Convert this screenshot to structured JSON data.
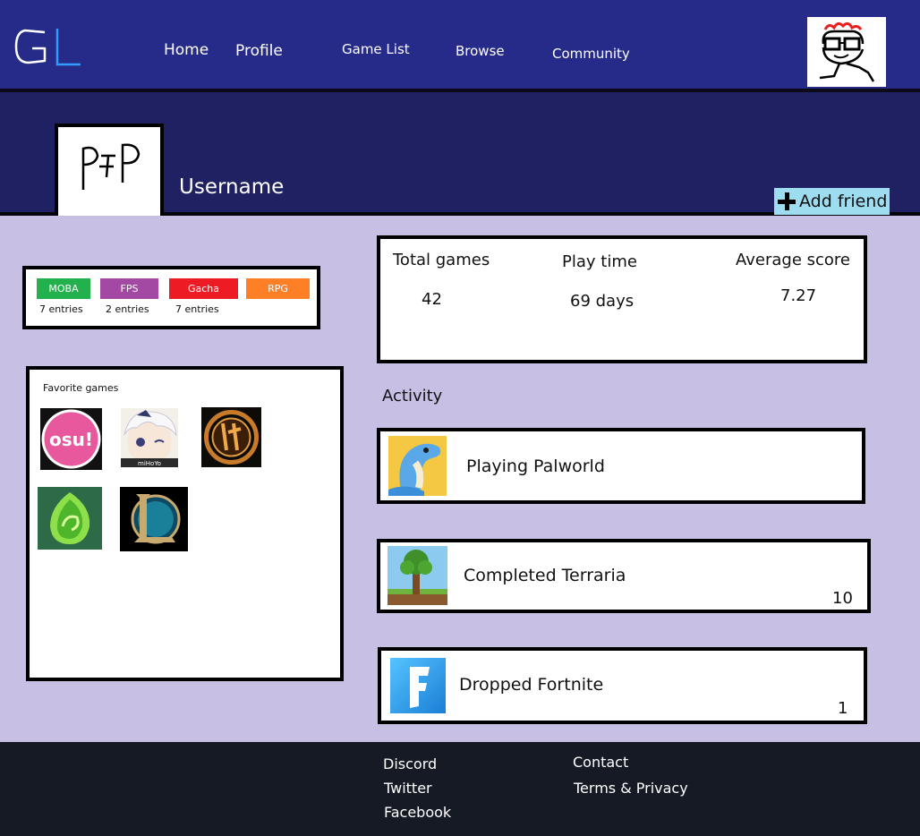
{
  "header": {
    "logo_text": "GL",
    "nav": {
      "home": "Home",
      "profile": "Profile",
      "game_list": "Game List",
      "browse": "Browse",
      "community": "Community"
    }
  },
  "profile": {
    "pfp_placeholder": "PFP",
    "username": "Username",
    "add_friend": "Add friend"
  },
  "tags": [
    {
      "label": "MOBA",
      "count": "7 entries",
      "color": "#22b14c"
    },
    {
      "label": "FPS",
      "count": "2 entries",
      "color": "#a349a4"
    },
    {
      "label": "Gacha",
      "count": "7 entries",
      "color": "#ed1c24"
    },
    {
      "label": "RPG",
      "count": "",
      "color": "#ff7f27"
    }
  ],
  "favorites": {
    "title": "Favorite games",
    "games": [
      {
        "icon": "osu-icon",
        "text": "osu!"
      },
      {
        "icon": "genshin-paimon-icon",
        "text": "miHoYo"
      },
      {
        "icon": "star-wars-old-republic-icon"
      },
      {
        "icon": "green-dragon-egg-icon"
      },
      {
        "icon": "league-of-legends-icon"
      }
    ]
  },
  "stats": {
    "total_games_label": "Total games",
    "total_games": "42",
    "play_time_label": "Play time",
    "play_time": "69 days",
    "avg_score_label": "Average score",
    "avg_score": "7.27"
  },
  "activity": {
    "heading": "Activity",
    "items": [
      {
        "text": "Playing Palworld",
        "score": "",
        "icon": "palworld-icon"
      },
      {
        "text": "Completed Terraria",
        "score": "10",
        "icon": "terraria-icon"
      },
      {
        "text": "Dropped Fortnite",
        "score": "1",
        "icon": "fortnite-icon"
      }
    ]
  },
  "footer": {
    "discord": "Discord",
    "twitter": "Twitter",
    "facebook": "Facebook",
    "contact": "Contact",
    "terms": "Terms & Privacy"
  }
}
